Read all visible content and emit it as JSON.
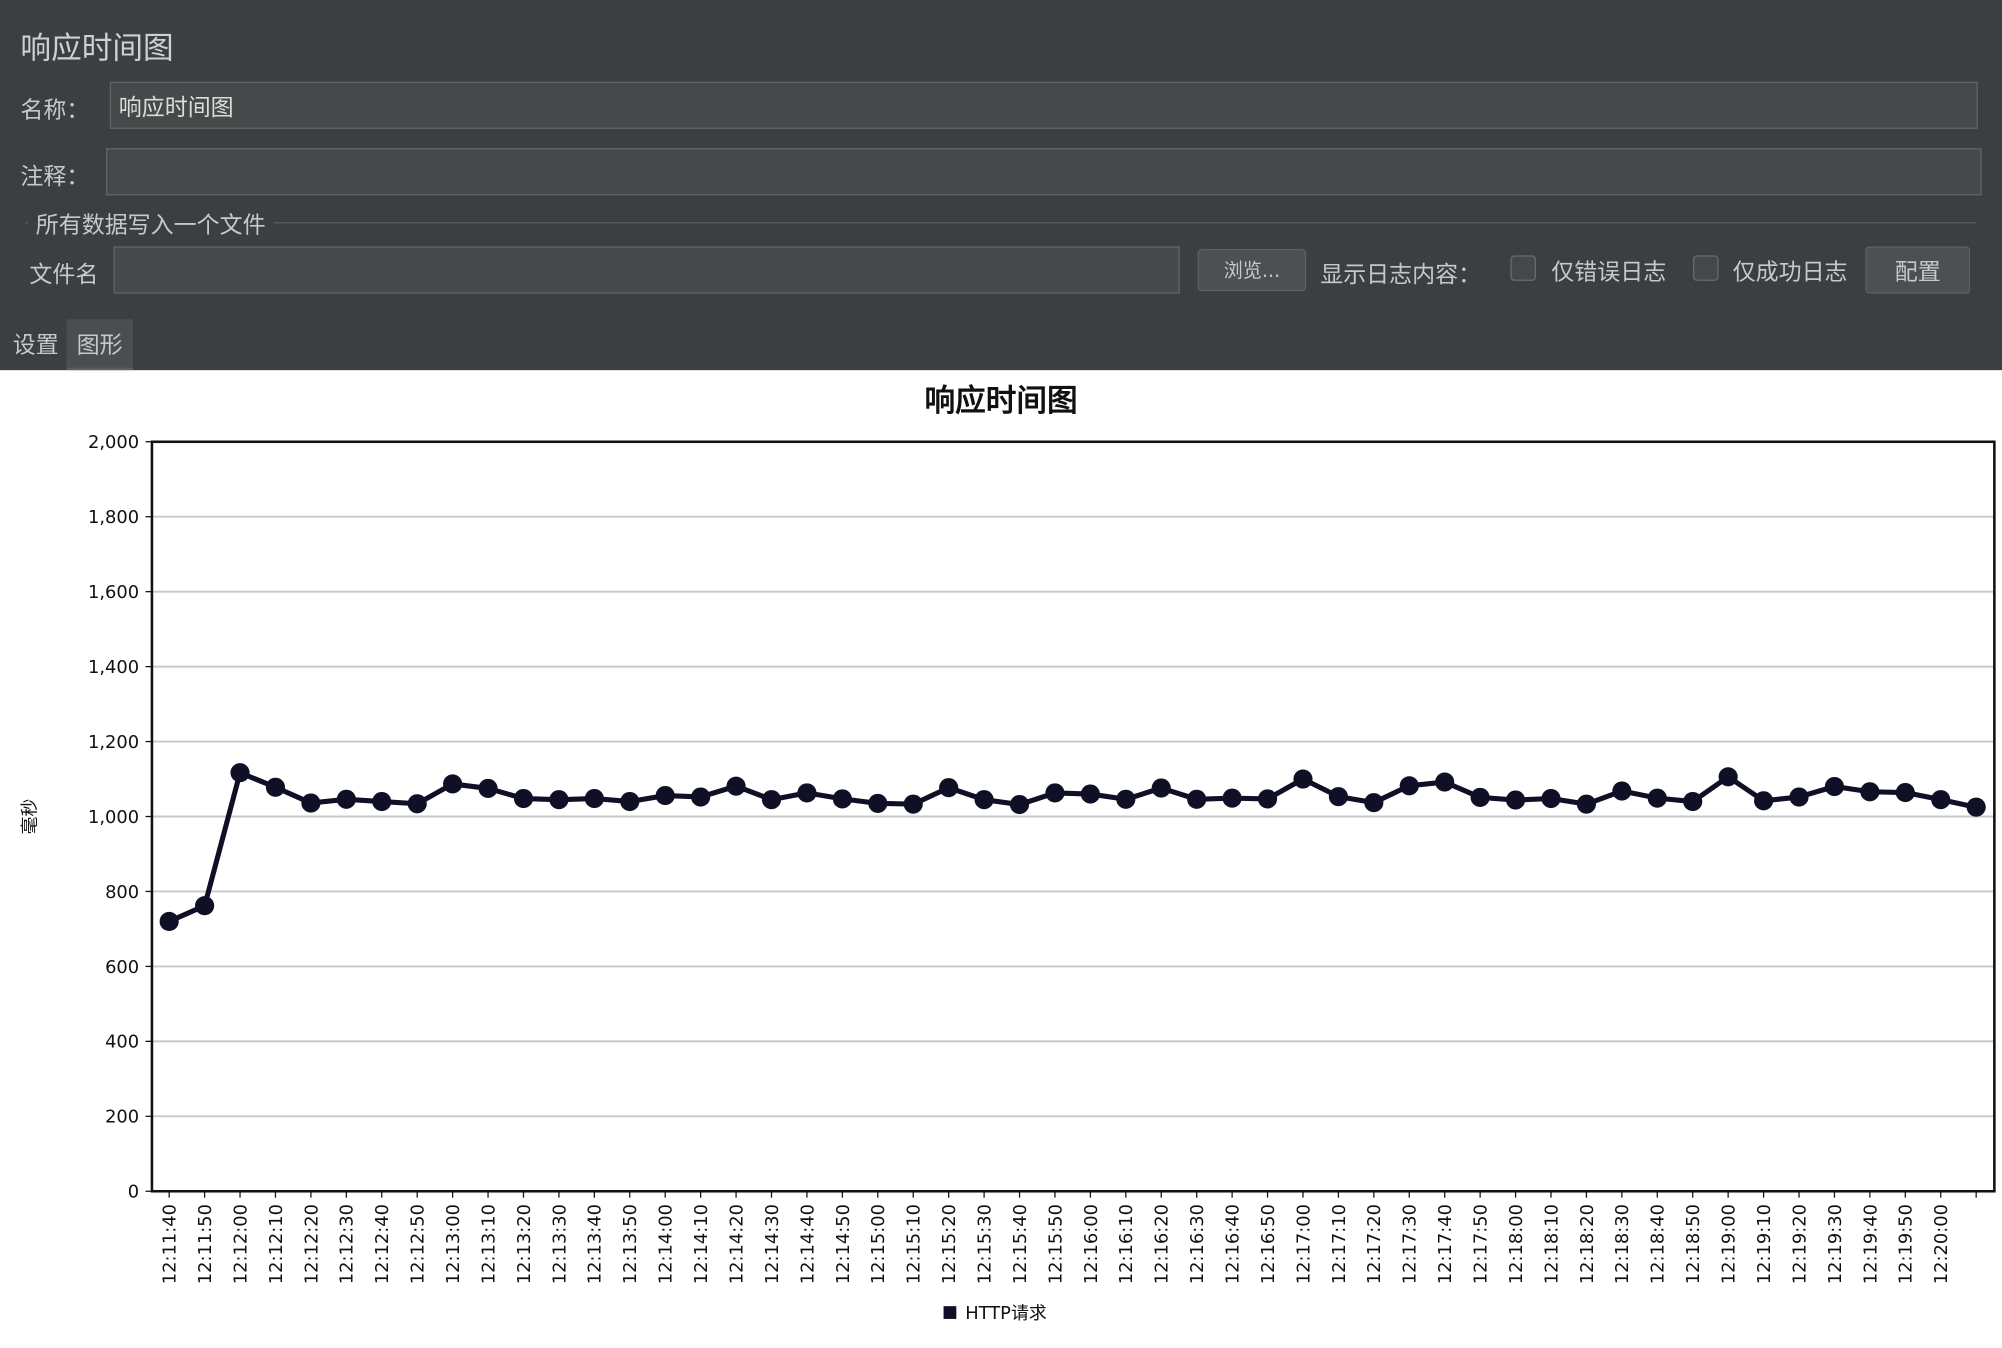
{
  "panel": {
    "title": "响应时间图",
    "name_label": "名称：",
    "name_value": "响应时间图",
    "comment_label": "注释：",
    "comment_value": "",
    "file_group_title": "所有数据写入一个文件",
    "filename_label": "文件名",
    "filename_value": "",
    "browse_label": "浏览...",
    "log_content_label": "显示日志内容：",
    "errors_only_label": "仅错误日志",
    "errors_only_checked": false,
    "success_only_label": "仅成功日志",
    "success_only_checked": false,
    "configure_label": "配置"
  },
  "tabs": {
    "settings_label": "设置",
    "graph_label": "图形",
    "active": "graph"
  },
  "chart_data": {
    "type": "line",
    "title": "响应时间图",
    "xlabel": "",
    "ylabel": "毫秒",
    "ylim": [
      0,
      2000
    ],
    "y_ticks": [
      0,
      200,
      400,
      600,
      800,
      1000,
      1200,
      1400,
      1600,
      1800,
      2000
    ],
    "y_tick_labels": [
      "0",
      "200",
      "400",
      "600",
      "800",
      "1,000",
      "1,200",
      "1,400",
      "1,600",
      "1,800",
      "2,000"
    ],
    "grid": true,
    "legend_position": "bottom",
    "x": [
      "12:11:40",
      "12:11:50",
      "12:12:00",
      "12:12:10",
      "12:12:20",
      "12:12:30",
      "12:12:40",
      "12:12:50",
      "12:13:00",
      "12:13:10",
      "12:13:20",
      "12:13:30",
      "12:13:40",
      "12:13:50",
      "12:14:00",
      "12:14:10",
      "12:14:20",
      "12:14:30",
      "12:14:40",
      "12:14:50",
      "12:15:00",
      "12:15:10",
      "12:15:20",
      "12:15:30",
      "12:15:40",
      "12:15:50",
      "12:16:00",
      "12:16:10",
      "12:16:20",
      "12:16:30",
      "12:16:40",
      "12:16:50",
      "12:17:00",
      "12:17:10",
      "12:17:20",
      "12:17:30",
      "12:17:40",
      "12:17:50",
      "12:18:00",
      "12:18:10",
      "12:18:20",
      "12:18:30",
      "12:18:40",
      "12:18:50",
      "12:19:00",
      "12:19:10",
      "12:19:20",
      "12:19:30",
      "12:19:40",
      "12:19:50",
      "12:20:00",
      ""
    ],
    "series": [
      {
        "name": "HTTP请求",
        "color": "#0f0f26",
        "values": [
          720,
          762,
          1117,
          1078,
          1036,
          1046,
          1040,
          1034,
          1087,
          1075,
          1048,
          1045,
          1048,
          1040,
          1056,
          1052,
          1081,
          1045,
          1063,
          1047,
          1035,
          1033,
          1077,
          1045,
          1032,
          1063,
          1060,
          1046,
          1076,
          1046,
          1049,
          1047,
          1100,
          1053,
          1037,
          1082,
          1092,
          1051,
          1044,
          1048,
          1033,
          1068,
          1049,
          1040,
          1106,
          1042,
          1052,
          1080,
          1066,
          1064,
          1045,
          1025
        ]
      }
    ]
  }
}
